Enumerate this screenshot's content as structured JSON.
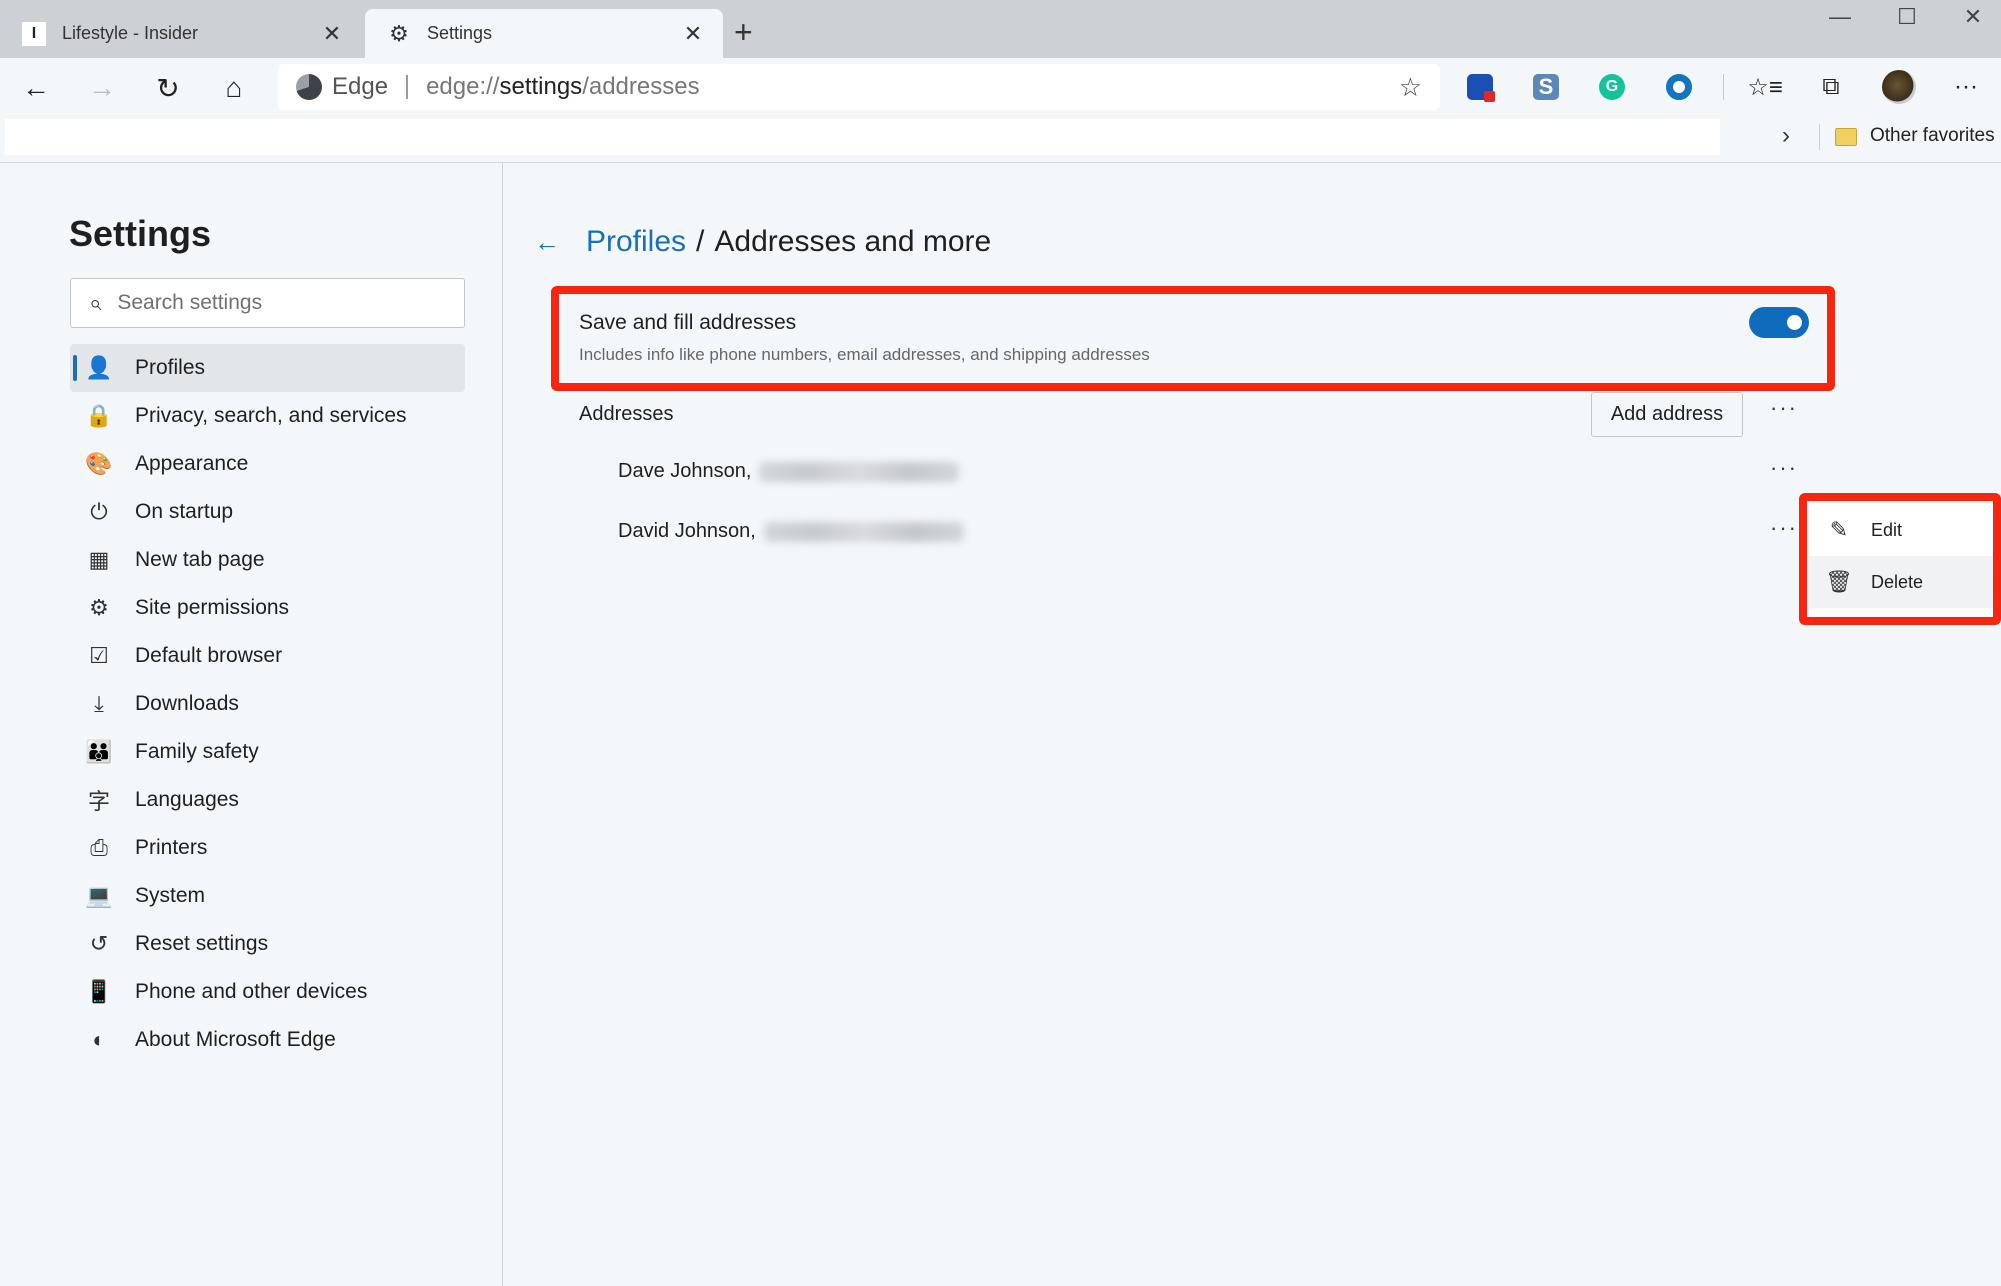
{
  "browser": {
    "tabs": [
      {
        "title": "Lifestyle - Insider",
        "favicon": "I",
        "active": false
      },
      {
        "title": "Settings",
        "favicon": "gear-icon",
        "active": true
      }
    ],
    "new_tab_icon": "+",
    "window_controls": {
      "minimize": "—",
      "maximize": "☐",
      "close": "✕"
    },
    "toolbar": {
      "back_icon": "←",
      "forward_icon": "→",
      "refresh_icon": "↻",
      "home_icon": "⌂",
      "site_label": "Edge",
      "url_prefix": "edge://",
      "url_host": "settings",
      "url_path": "/addresses",
      "favorite_star": "☆",
      "favorites_icon": "☆≡",
      "collections_icon": "⧉",
      "more_icon": "···"
    },
    "favorites_bar": {
      "chevron": "›",
      "other_favorites": "Other favorites"
    }
  },
  "sidebar": {
    "title": "Settings",
    "search_placeholder": "Search settings",
    "items": [
      {
        "label": "Profiles",
        "icon": "👤",
        "selected": true
      },
      {
        "label": "Privacy, search, and services",
        "icon": "🔒"
      },
      {
        "label": "Appearance",
        "icon": "🎨"
      },
      {
        "label": "On startup",
        "icon": "⏻"
      },
      {
        "label": "New tab page",
        "icon": "▦"
      },
      {
        "label": "Site permissions",
        "icon": "⚙"
      },
      {
        "label": "Default browser",
        "icon": "☑"
      },
      {
        "label": "Downloads",
        "icon": "⤓"
      },
      {
        "label": "Family safety",
        "icon": "👪"
      },
      {
        "label": "Languages",
        "icon": "字"
      },
      {
        "label": "Printers",
        "icon": "⎙"
      },
      {
        "label": "System",
        "icon": "💻"
      },
      {
        "label": "Reset settings",
        "icon": "↺"
      },
      {
        "label": "Phone and other devices",
        "icon": "📱"
      },
      {
        "label": "About Microsoft Edge",
        "icon": "◐"
      }
    ]
  },
  "main": {
    "breadcrumb": {
      "back_icon": "←",
      "parent": "Profiles",
      "separator": "/",
      "current": "Addresses and more"
    },
    "save_fill": {
      "title": "Save and fill addresses",
      "description": "Includes info like phone numbers, email addresses, and shipping addresses",
      "enabled": true
    },
    "addresses": {
      "heading": "Addresses",
      "add_button": "Add address",
      "more_icon": "···",
      "entries": [
        {
          "name": "Dave Johnson,"
        },
        {
          "name": "David Johnson,"
        }
      ]
    },
    "context_menu": {
      "items": [
        {
          "label": "Edit",
          "icon": "✎"
        },
        {
          "label": "Delete",
          "icon": "🗑"
        }
      ]
    }
  },
  "colors": {
    "accent": "#0f6cbd",
    "highlight_red": "#f5260f",
    "page_bg": "#f4f7fa",
    "tabbar_bg": "#cdd0d4"
  }
}
